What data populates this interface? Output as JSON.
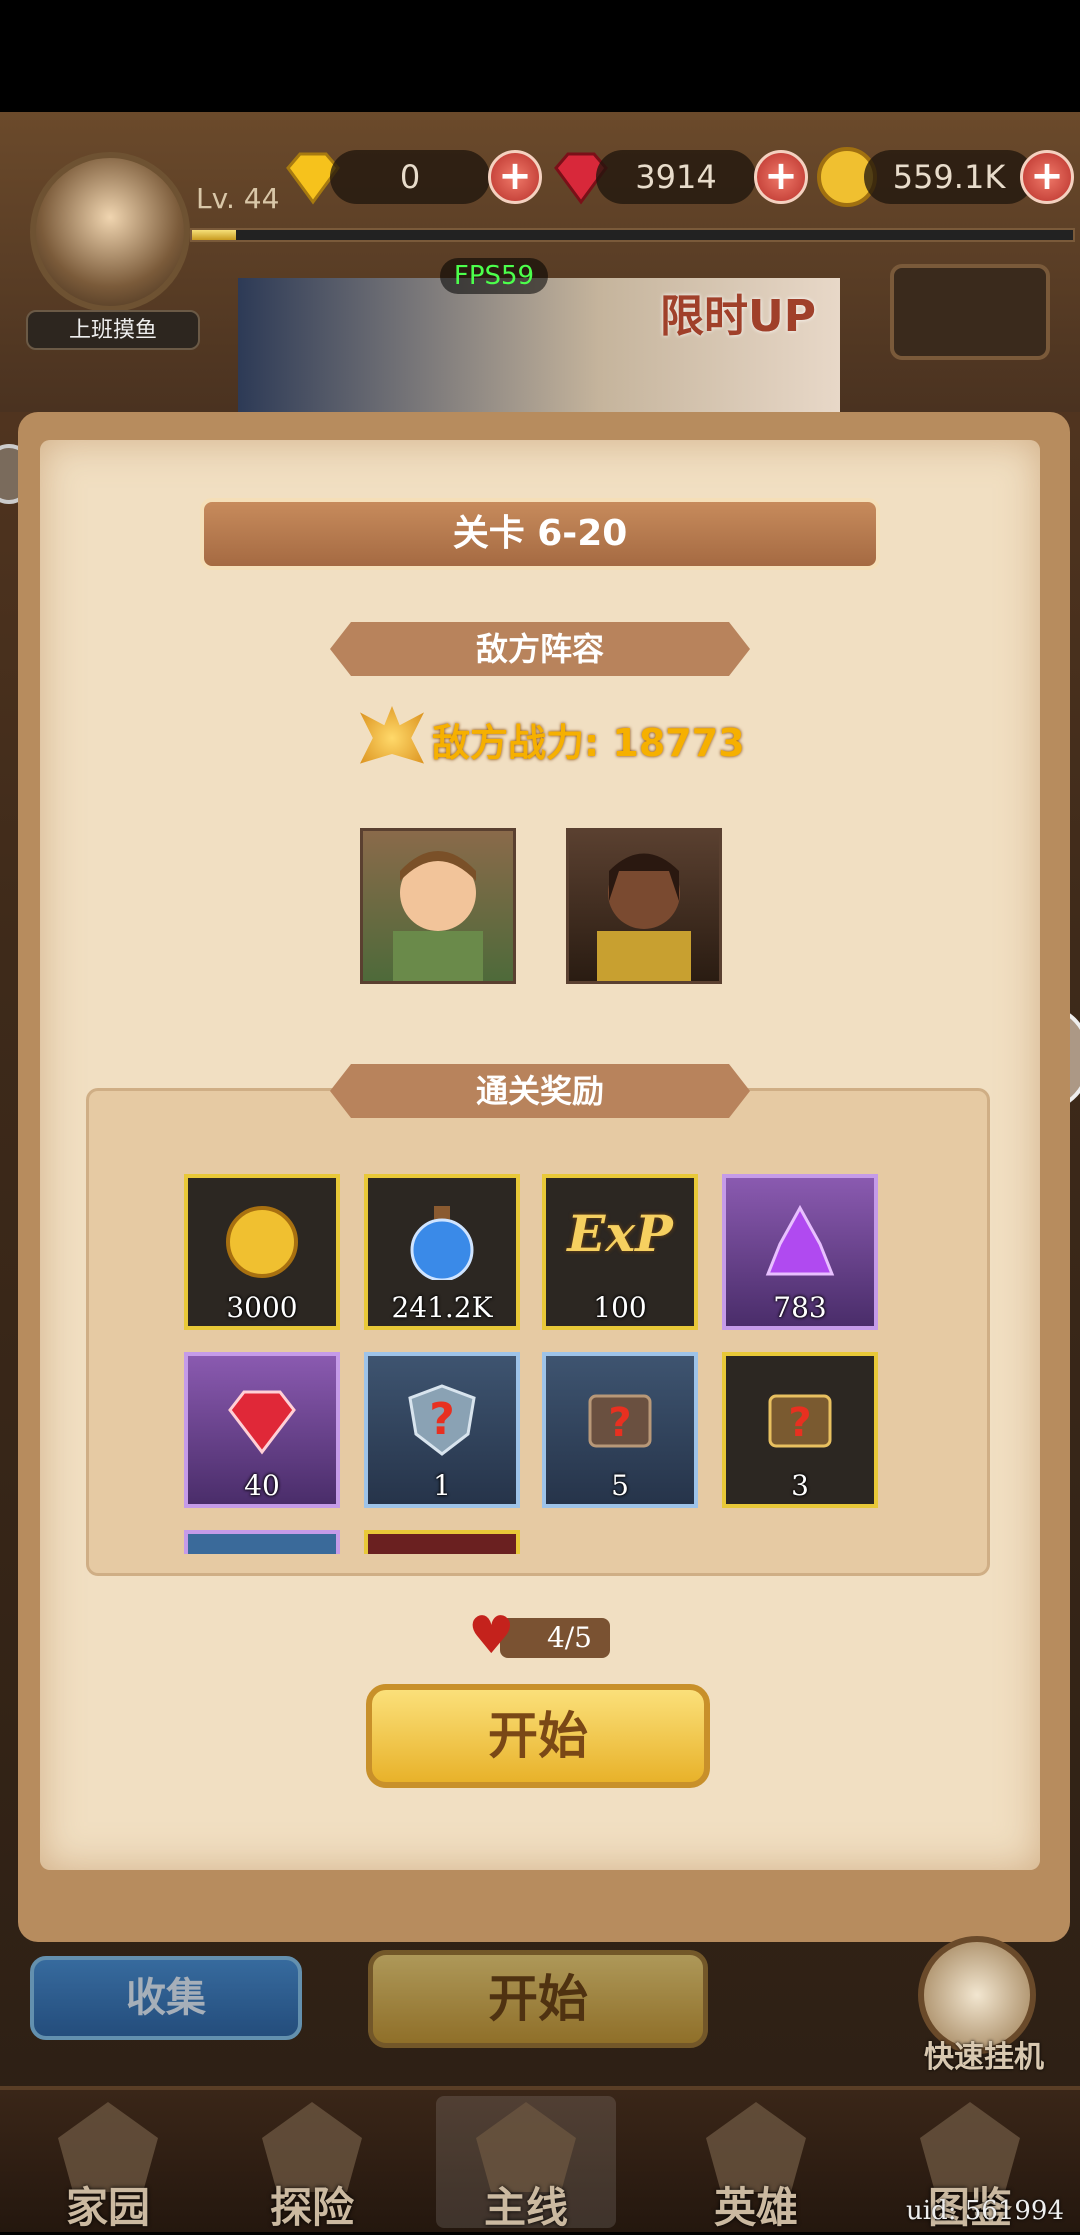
{
  "hud": {
    "nickname": "上班摸鱼",
    "level": "Lv. 44",
    "xp_fraction": 0.05,
    "resources": {
      "diamond_yellow": "0",
      "gem_red": "3914",
      "gold": "559.1K"
    }
  },
  "banner": {
    "title": "限时UP"
  },
  "fps": "FPS59",
  "dialog": {
    "stage_title": "关卡 6-20",
    "enemy_section": "敌方阵容",
    "enemy_power": "敌方战力: 18773",
    "rewards_section": "通关奖励",
    "rewards": [
      {
        "icon": "gold-coin-icon",
        "count": "3000"
      },
      {
        "icon": "blue-potion-icon",
        "count": "241.2K"
      },
      {
        "icon": "exp-icon",
        "count": "100",
        "label": "ExP"
      },
      {
        "icon": "purple-crystal-icon",
        "count": "783"
      },
      {
        "icon": "red-gem-icon",
        "count": "40"
      },
      {
        "icon": "mystery-shield-icon",
        "count": "1"
      },
      {
        "icon": "mystery-book-icon",
        "count": "5"
      },
      {
        "icon": "mystery-book-gold-icon",
        "count": "3"
      }
    ],
    "energy": "4/5",
    "start_label": "开始"
  },
  "bottom": {
    "collect_label": "收集",
    "start_label": "开始",
    "idle_label": "快速挂机"
  },
  "nav": {
    "items": [
      "家园",
      "探险",
      "主线",
      "英雄",
      "图鉴"
    ]
  },
  "uid": "uid: 561994",
  "colors": {
    "accent_gold": "#f6b000",
    "panel": "#f1dfc2",
    "section_header": "#b8835c"
  }
}
